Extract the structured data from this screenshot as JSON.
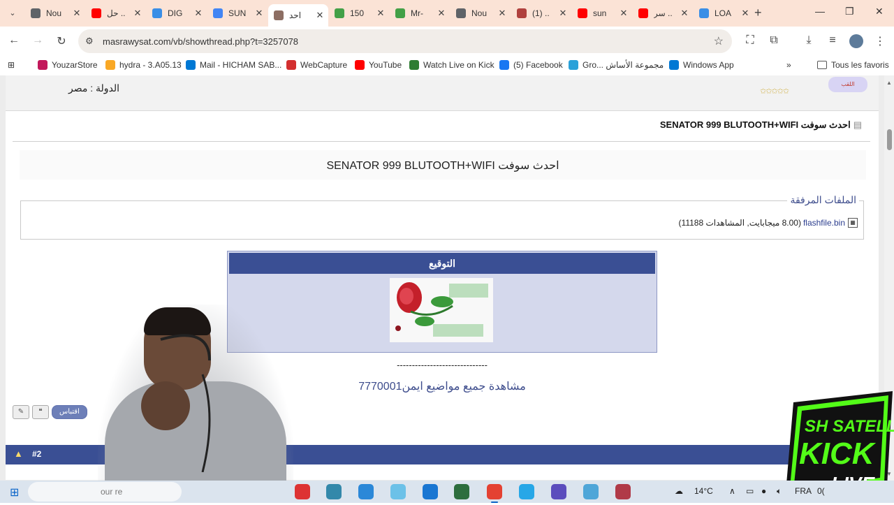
{
  "browser": {
    "tabs": [
      {
        "title": "Nou",
        "color": "#5f6368",
        "active": false
      },
      {
        "title": "حل ..",
        "color": "#ff0000",
        "active": false
      },
      {
        "title": "DIG",
        "color": "#3a8ee6",
        "active": false
      },
      {
        "title": "SUN",
        "color": "#4285f4",
        "active": false
      },
      {
        "title": "احد",
        "color": "#8d6e63",
        "active": true
      },
      {
        "title": "150",
        "color": "#43a047",
        "active": false
      },
      {
        "title": "Mr-",
        "color": "#43a047",
        "active": false
      },
      {
        "title": "Nou",
        "color": "#5f6368",
        "active": false
      },
      {
        "title": "(1) ..",
        "color": "#b0413e",
        "active": false
      },
      {
        "title": "sun",
        "color": "#ff0000",
        "active": false
      },
      {
        "title": "سر ..",
        "color": "#ff0000",
        "active": false
      },
      {
        "title": "LOA",
        "color": "#3a8ee6",
        "active": false
      }
    ],
    "new_tab": "+",
    "url": "masrawysat.com/vb/showthread.php?t=3257078"
  },
  "bookmarks": [
    {
      "label": "YouzarStore",
      "color": "#c2185b"
    },
    {
      "label": "hydra - 3.A05.13",
      "color": "#f9a825"
    },
    {
      "label": "Mail - HICHAM SAB...",
      "color": "#0078d4"
    },
    {
      "label": "WebCapture",
      "color": "#d32f2f"
    },
    {
      "label": "YouTube",
      "color": "#ff0000"
    },
    {
      "label": "Watch Live on Kick",
      "color": "#2e7d32"
    },
    {
      "label": "(5) Facebook",
      "color": "#1877f2"
    },
    {
      "label": "Gro... مجموعة الأساش",
      "color": "#2aa1d9"
    },
    {
      "label": "Windows App",
      "color": "#0078d4"
    }
  ],
  "bookmarks_more": "»",
  "all_bookmarks": "Tous les favoris",
  "post": {
    "country": "الدولة : مصر",
    "rank_badge": "اللقب",
    "stars": "✩✩✩✩✩",
    "title": "احدث سوفت SENATOR 999 BLUTOOTH+WIFI",
    "message": "احدث سوفت SENATOR 999 BLUTOOTH+WIFI",
    "attachments_label": "الملفات المرفقة",
    "file_name": "flashfile.bin",
    "file_info": "(8.00 ميجابايت, المشاهدات 11188)",
    "signature_header": "التوقيع",
    "signature_rule": "------------------------------",
    "signature_link": "مشاهدة جميع مواضيع ايمن7770001",
    "quote_button": "اقتباس",
    "next_post": "#2"
  },
  "taskbar": {
    "search_placeholder": "our re",
    "weather": "14°C",
    "language": "FRA",
    "clock": "0("
  },
  "overlay": {
    "logo_line1": "SH SATELLITE",
    "logo_line2": "KICK",
    "logo_line3": "LIVE"
  }
}
